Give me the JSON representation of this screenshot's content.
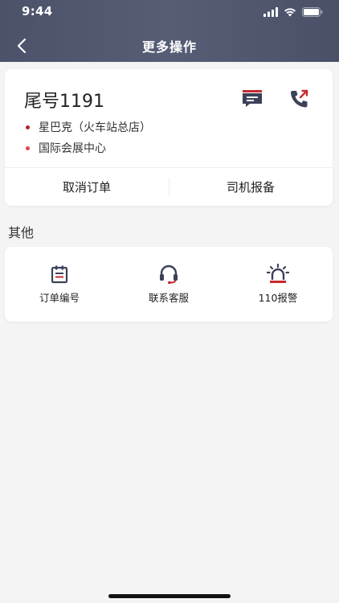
{
  "status_bar": {
    "time": "9:44"
  },
  "nav": {
    "title": "更多操作",
    "back_icon": "chevron-left-icon"
  },
  "order": {
    "tail_number": "尾号1191",
    "from_address": "星巴克（火车站总店）",
    "to_address": "国际会展中心",
    "actions": {
      "cancel": "取消订单",
      "driver_report": "司机报备"
    },
    "icons": {
      "message": "chat-message-icon",
      "call": "phone-call-icon"
    }
  },
  "other": {
    "section_title": "其他",
    "items": [
      {
        "label": "订单编号",
        "icon": "order-number-icon"
      },
      {
        "label": "联系客服",
        "icon": "headset-icon"
      },
      {
        "label": "110报警",
        "icon": "alarm-siren-icon"
      }
    ]
  },
  "colors": {
    "header_bg": "#4f566d",
    "accent_red": "#c62a2f",
    "icon_dark": "#3b4258",
    "from_dot": "#b22222",
    "to_dot": "#e0464a",
    "page_bg": "#f4f4f4"
  }
}
